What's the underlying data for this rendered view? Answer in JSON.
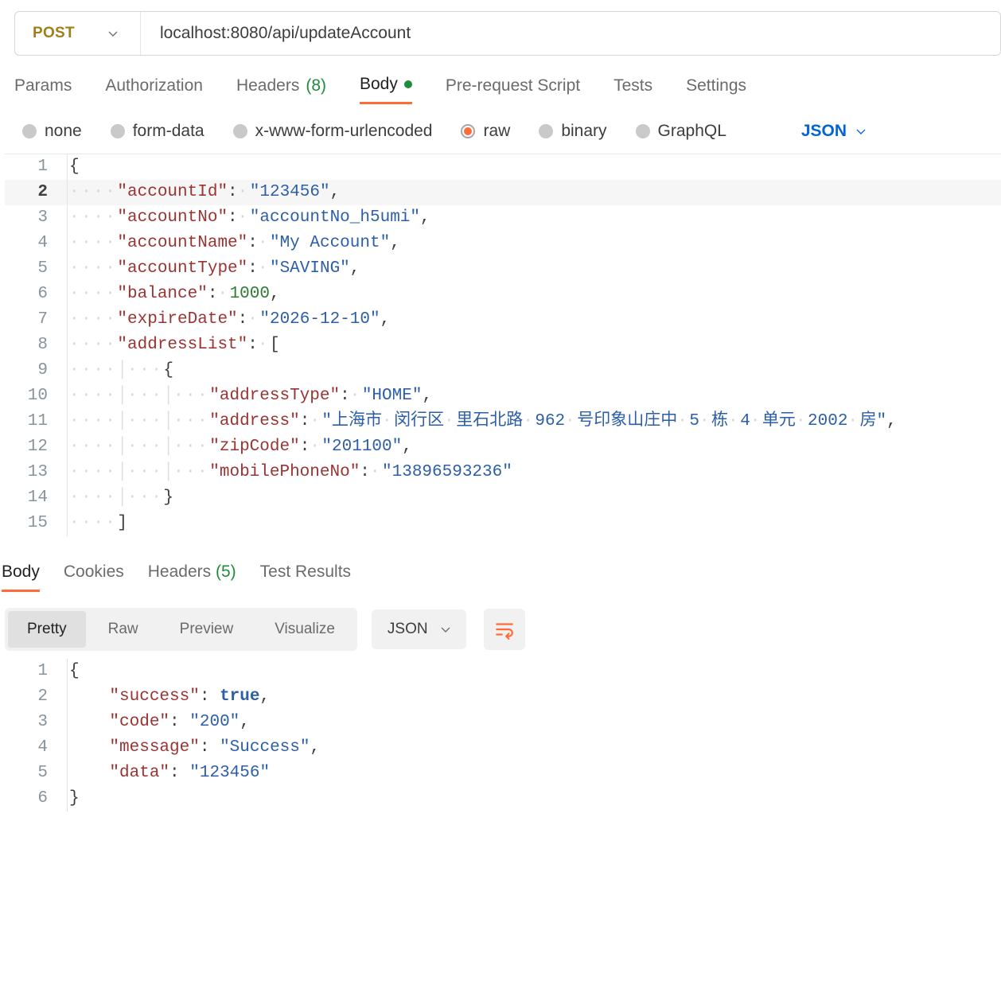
{
  "method": "POST",
  "url": "localhost:8080/api/updateAccount",
  "request_tabs": {
    "params": "Params",
    "auth": "Authorization",
    "headers_label": "Headers",
    "headers_count": "(8)",
    "body": "Body",
    "prerequest": "Pre-request Script",
    "tests": "Tests",
    "settings": "Settings"
  },
  "body_types": {
    "none": "none",
    "form": "form-data",
    "urlenc": "x-www-form-urlencoded",
    "raw": "raw",
    "binary": "binary",
    "graphql": "GraphQL"
  },
  "body_lang": "JSON",
  "request_body_json": {
    "accountId": "123456",
    "accountNo": "accountNo_h5umi",
    "accountName": "My Account",
    "accountType": "SAVING",
    "balance": 1000,
    "expireDate": "2026-12-10",
    "addressList": [
      {
        "addressType": "HOME",
        "address": "上海市 闵行区 里石北路 962 号印象山庄中 5 栋 4 单元 2002 房",
        "zipCode": "201100",
        "mobilePhoneNo": "13896593236"
      }
    ]
  },
  "request_lines": [
    {
      "n": "1",
      "html": "<span class='tok-pun'>{</span>"
    },
    {
      "n": "2",
      "hl": true,
      "html": "<span class='dots'>····</span><span class='tok-key'>\"accountId\"</span><span class='tok-pun'>:</span><span class='dots'>·</span><span class='tok-str'>\"123456\"</span><span class='tok-pun'>,</span>"
    },
    {
      "n": "3",
      "html": "<span class='dots'>····</span><span class='tok-key'>\"accountNo\"</span><span class='tok-pun'>:</span><span class='dots'>·</span><span class='tok-str'>\"accountNo_h5umi\"</span><span class='tok-pun'>,</span>"
    },
    {
      "n": "4",
      "html": "<span class='dots'>····</span><span class='tok-key'>\"accountName\"</span><span class='tok-pun'>:</span><span class='dots'>·</span><span class='tok-str'>\"My Account\"</span><span class='tok-pun'>,</span>"
    },
    {
      "n": "5",
      "html": "<span class='dots'>····</span><span class='tok-key'>\"accountType\"</span><span class='tok-pun'>:</span><span class='dots'>·</span><span class='tok-str'>\"SAVING\"</span><span class='tok-pun'>,</span>"
    },
    {
      "n": "6",
      "html": "<span class='dots'>····</span><span class='tok-key'>\"balance\"</span><span class='tok-pun'>:</span><span class='dots'>·</span><span class='tok-num'>1000</span><span class='tok-pun'>,</span>"
    },
    {
      "n": "7",
      "html": "<span class='dots'>····</span><span class='tok-key'>\"expireDate\"</span><span class='tok-pun'>:</span><span class='dots'>·</span><span class='tok-str'>\"2026-12-10\"</span><span class='tok-pun'>,</span>"
    },
    {
      "n": "8",
      "html": "<span class='dots'>····</span><span class='tok-key'>\"addressList\"</span><span class='tok-pun'>:</span><span class='dots'>·</span><span class='tok-pun'>[</span>"
    },
    {
      "n": "9",
      "html": "<span class='dots'>····</span><span class='bar'>│</span><span class='dots'>···</span><span class='tok-pun'>{</span>"
    },
    {
      "n": "10",
      "html": "<span class='dots'>····</span><span class='bar'>│</span><span class='dots'>···</span><span class='bar'>│</span><span class='dots'>···</span><span class='tok-key'>\"addressType\"</span><span class='tok-pun'>:</span><span class='dots'>·</span><span class='tok-str'>\"HOME\"</span><span class='tok-pun'>,</span>"
    },
    {
      "n": "11",
      "html": "<span class='dots'>····</span><span class='bar'>│</span><span class='dots'>···</span><span class='bar'>│</span><span class='dots'>···</span><span class='tok-key'>\"address\"</span><span class='tok-pun'>:</span><span class='dots'>·</span><span class='tok-str'>\"上海市<span class='dots'>·</span>闵行区<span class='dots'>·</span>里石北路<span class='dots'>·</span>962<span class='dots'>·</span>号印象山庄中<span class='dots'>·</span>5<span class='dots'>·</span>栋<span class='dots'>·</span>4<span class='dots'>·</span>单元<span class='dots'>·</span>2002<span class='dots'>·</span>房\"</span><span class='tok-pun'>,</span>"
    },
    {
      "n": "12",
      "html": "<span class='dots'>····</span><span class='bar'>│</span><span class='dots'>···</span><span class='bar'>│</span><span class='dots'>···</span><span class='tok-key'>\"zipCode\"</span><span class='tok-pun'>:</span><span class='dots'>·</span><span class='tok-str'>\"201100\"</span><span class='tok-pun'>,</span>"
    },
    {
      "n": "13",
      "html": "<span class='dots'>····</span><span class='bar'>│</span><span class='dots'>···</span><span class='bar'>│</span><span class='dots'>···</span><span class='tok-key'>\"mobilePhoneNo\"</span><span class='tok-pun'>:</span><span class='dots'>·</span><span class='tok-str'>\"13896593236\"</span>"
    },
    {
      "n": "14",
      "html": "<span class='dots'>····</span><span class='bar'>│</span><span class='dots'>···</span><span class='tok-pun'>}</span>"
    },
    {
      "n": "15",
      "html": "<span class='dots'>····</span><span class='tok-pun'>]</span>"
    }
  ],
  "response_tabs": {
    "body": "Body",
    "cookies": "Cookies",
    "headers_label": "Headers",
    "headers_count": "(5)",
    "test_results": "Test Results"
  },
  "view_modes": {
    "pretty": "Pretty",
    "raw": "Raw",
    "preview": "Preview",
    "visualize": "Visualize"
  },
  "resp_lang": "JSON",
  "response_body_json": {
    "success": true,
    "code": "200",
    "message": "Success",
    "data": "123456"
  },
  "response_lines": [
    {
      "n": "1",
      "html": "<span class='tok-pun'>{</span>"
    },
    {
      "n": "2",
      "html": "    <span class='tok-key'>\"success\"</span><span class='tok-pun'>: </span><span class='tok-bool'>true</span><span class='tok-pun'>,</span>"
    },
    {
      "n": "3",
      "html": "    <span class='tok-key'>\"code\"</span><span class='tok-pun'>: </span><span class='tok-str'>\"200\"</span><span class='tok-pun'>,</span>"
    },
    {
      "n": "4",
      "html": "    <span class='tok-key'>\"message\"</span><span class='tok-pun'>: </span><span class='tok-str'>\"Success\"</span><span class='tok-pun'>,</span>"
    },
    {
      "n": "5",
      "html": "    <span class='tok-key'>\"data\"</span><span class='tok-pun'>: </span><span class='tok-str'>\"123456\"</span>"
    },
    {
      "n": "6",
      "html": "<span class='tok-pun'>}</span>"
    }
  ]
}
